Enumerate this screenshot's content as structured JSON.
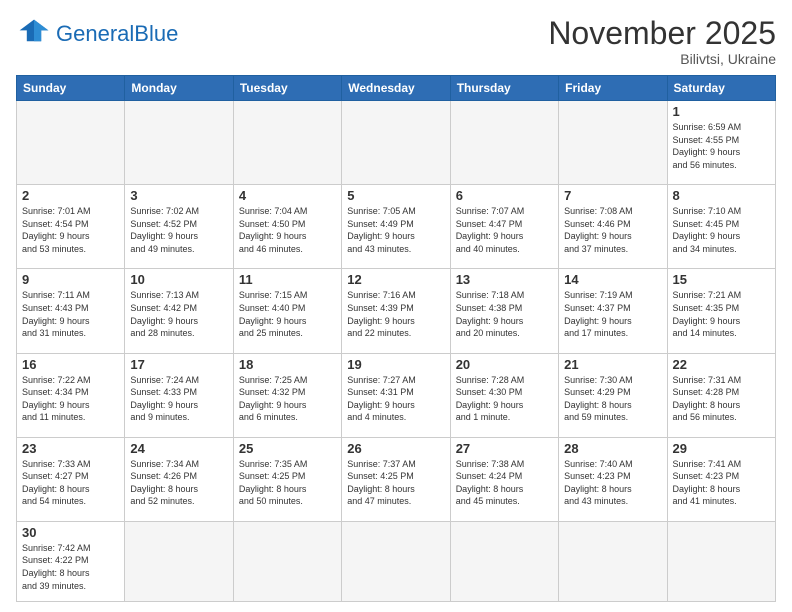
{
  "header": {
    "logo_general": "General",
    "logo_blue": "Blue",
    "title": "November 2025",
    "subtitle": "Bilivtsi, Ukraine"
  },
  "weekdays": [
    "Sunday",
    "Monday",
    "Tuesday",
    "Wednesday",
    "Thursday",
    "Friday",
    "Saturday"
  ],
  "weeks": [
    [
      {
        "day": "",
        "info": ""
      },
      {
        "day": "",
        "info": ""
      },
      {
        "day": "",
        "info": ""
      },
      {
        "day": "",
        "info": ""
      },
      {
        "day": "",
        "info": ""
      },
      {
        "day": "",
        "info": ""
      },
      {
        "day": "1",
        "info": "Sunrise: 6:59 AM\nSunset: 4:55 PM\nDaylight: 9 hours\nand 56 minutes."
      }
    ],
    [
      {
        "day": "2",
        "info": "Sunrise: 7:01 AM\nSunset: 4:54 PM\nDaylight: 9 hours\nand 53 minutes."
      },
      {
        "day": "3",
        "info": "Sunrise: 7:02 AM\nSunset: 4:52 PM\nDaylight: 9 hours\nand 49 minutes."
      },
      {
        "day": "4",
        "info": "Sunrise: 7:04 AM\nSunset: 4:50 PM\nDaylight: 9 hours\nand 46 minutes."
      },
      {
        "day": "5",
        "info": "Sunrise: 7:05 AM\nSunset: 4:49 PM\nDaylight: 9 hours\nand 43 minutes."
      },
      {
        "day": "6",
        "info": "Sunrise: 7:07 AM\nSunset: 4:47 PM\nDaylight: 9 hours\nand 40 minutes."
      },
      {
        "day": "7",
        "info": "Sunrise: 7:08 AM\nSunset: 4:46 PM\nDaylight: 9 hours\nand 37 minutes."
      },
      {
        "day": "8",
        "info": "Sunrise: 7:10 AM\nSunset: 4:45 PM\nDaylight: 9 hours\nand 34 minutes."
      }
    ],
    [
      {
        "day": "9",
        "info": "Sunrise: 7:11 AM\nSunset: 4:43 PM\nDaylight: 9 hours\nand 31 minutes."
      },
      {
        "day": "10",
        "info": "Sunrise: 7:13 AM\nSunset: 4:42 PM\nDaylight: 9 hours\nand 28 minutes."
      },
      {
        "day": "11",
        "info": "Sunrise: 7:15 AM\nSunset: 4:40 PM\nDaylight: 9 hours\nand 25 minutes."
      },
      {
        "day": "12",
        "info": "Sunrise: 7:16 AM\nSunset: 4:39 PM\nDaylight: 9 hours\nand 22 minutes."
      },
      {
        "day": "13",
        "info": "Sunrise: 7:18 AM\nSunset: 4:38 PM\nDaylight: 9 hours\nand 20 minutes."
      },
      {
        "day": "14",
        "info": "Sunrise: 7:19 AM\nSunset: 4:37 PM\nDaylight: 9 hours\nand 17 minutes."
      },
      {
        "day": "15",
        "info": "Sunrise: 7:21 AM\nSunset: 4:35 PM\nDaylight: 9 hours\nand 14 minutes."
      }
    ],
    [
      {
        "day": "16",
        "info": "Sunrise: 7:22 AM\nSunset: 4:34 PM\nDaylight: 9 hours\nand 11 minutes."
      },
      {
        "day": "17",
        "info": "Sunrise: 7:24 AM\nSunset: 4:33 PM\nDaylight: 9 hours\nand 9 minutes."
      },
      {
        "day": "18",
        "info": "Sunrise: 7:25 AM\nSunset: 4:32 PM\nDaylight: 9 hours\nand 6 minutes."
      },
      {
        "day": "19",
        "info": "Sunrise: 7:27 AM\nSunset: 4:31 PM\nDaylight: 9 hours\nand 4 minutes."
      },
      {
        "day": "20",
        "info": "Sunrise: 7:28 AM\nSunset: 4:30 PM\nDaylight: 9 hours\nand 1 minute."
      },
      {
        "day": "21",
        "info": "Sunrise: 7:30 AM\nSunset: 4:29 PM\nDaylight: 8 hours\nand 59 minutes."
      },
      {
        "day": "22",
        "info": "Sunrise: 7:31 AM\nSunset: 4:28 PM\nDaylight: 8 hours\nand 56 minutes."
      }
    ],
    [
      {
        "day": "23",
        "info": "Sunrise: 7:33 AM\nSunset: 4:27 PM\nDaylight: 8 hours\nand 54 minutes."
      },
      {
        "day": "24",
        "info": "Sunrise: 7:34 AM\nSunset: 4:26 PM\nDaylight: 8 hours\nand 52 minutes."
      },
      {
        "day": "25",
        "info": "Sunrise: 7:35 AM\nSunset: 4:25 PM\nDaylight: 8 hours\nand 50 minutes."
      },
      {
        "day": "26",
        "info": "Sunrise: 7:37 AM\nSunset: 4:25 PM\nDaylight: 8 hours\nand 47 minutes."
      },
      {
        "day": "27",
        "info": "Sunrise: 7:38 AM\nSunset: 4:24 PM\nDaylight: 8 hours\nand 45 minutes."
      },
      {
        "day": "28",
        "info": "Sunrise: 7:40 AM\nSunset: 4:23 PM\nDaylight: 8 hours\nand 43 minutes."
      },
      {
        "day": "29",
        "info": "Sunrise: 7:41 AM\nSunset: 4:23 PM\nDaylight: 8 hours\nand 41 minutes."
      }
    ],
    [
      {
        "day": "30",
        "info": "Sunrise: 7:42 AM\nSunset: 4:22 PM\nDaylight: 8 hours\nand 39 minutes."
      },
      {
        "day": "",
        "info": ""
      },
      {
        "day": "",
        "info": ""
      },
      {
        "day": "",
        "info": ""
      },
      {
        "day": "",
        "info": ""
      },
      {
        "day": "",
        "info": ""
      },
      {
        "day": "",
        "info": ""
      }
    ]
  ]
}
